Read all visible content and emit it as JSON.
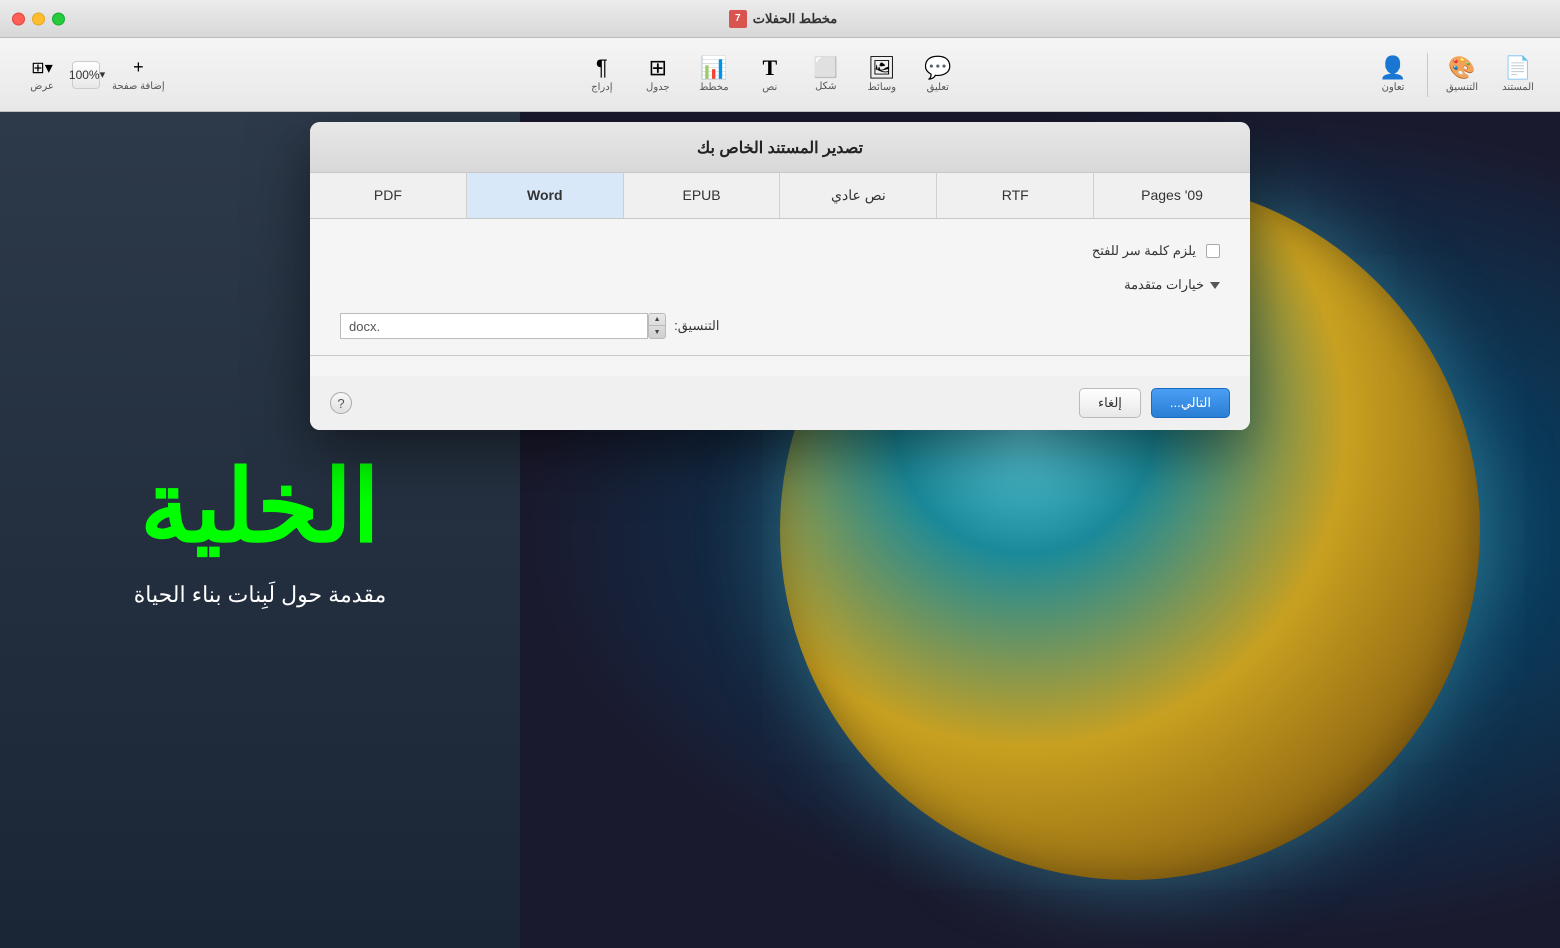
{
  "titlebar": {
    "title": "مخطط الحفلات",
    "icon_label": "7"
  },
  "toolbar": {
    "groups": [
      {
        "id": "right-group",
        "buttons": [
          {
            "id": "document",
            "icon": "📄",
            "label": "المستند"
          },
          {
            "id": "format",
            "icon": "🎨",
            "label": "التنسيق"
          }
        ]
      },
      {
        "id": "middle-group",
        "buttons": [
          {
            "id": "collaborate",
            "icon": "👤",
            "label": "تعاون"
          }
        ]
      },
      {
        "id": "insert-group",
        "buttons": [
          {
            "id": "comment",
            "icon": "💬",
            "label": "تعليق"
          },
          {
            "id": "media",
            "icon": "🖼",
            "label": "وسائط"
          },
          {
            "id": "shape",
            "icon": "⬜",
            "label": "شكل"
          },
          {
            "id": "text",
            "icon": "T",
            "label": "نص"
          },
          {
            "id": "chart",
            "icon": "📊",
            "label": "مخطط"
          },
          {
            "id": "table",
            "icon": "⊞",
            "label": "جدول"
          },
          {
            "id": "insert",
            "icon": "¶",
            "label": "إدراج"
          }
        ]
      }
    ],
    "zoom": {
      "value": "100%",
      "add_page_label": "إضافة صفحة",
      "view_label": "عرض"
    }
  },
  "dialog": {
    "title": "تصدير المستند الخاص بك",
    "tabs": [
      {
        "id": "pdf",
        "label": "PDF",
        "active": false
      },
      {
        "id": "word",
        "label": "Word",
        "active": true
      },
      {
        "id": "epub",
        "label": "EPUB",
        "active": false
      },
      {
        "id": "plaintext",
        "label": "نص عادي",
        "active": false
      },
      {
        "id": "rtf",
        "label": "RTF",
        "active": false
      },
      {
        "id": "pages09",
        "label": "Pages '09",
        "active": false
      }
    ],
    "password_label": "يلزم كلمة سر للفتح",
    "advanced_label": "خيارات متقدمة",
    "format_label": "التنسيق:",
    "format_ext": ".docx",
    "format_value": "",
    "buttons": {
      "next": "التالي...",
      "cancel": "إلغاء",
      "help": "?"
    }
  },
  "background": {
    "arabic_large": "الخلية",
    "arabic_subtitle": "مقدمة حول لَبِنات بناء الحياة"
  }
}
